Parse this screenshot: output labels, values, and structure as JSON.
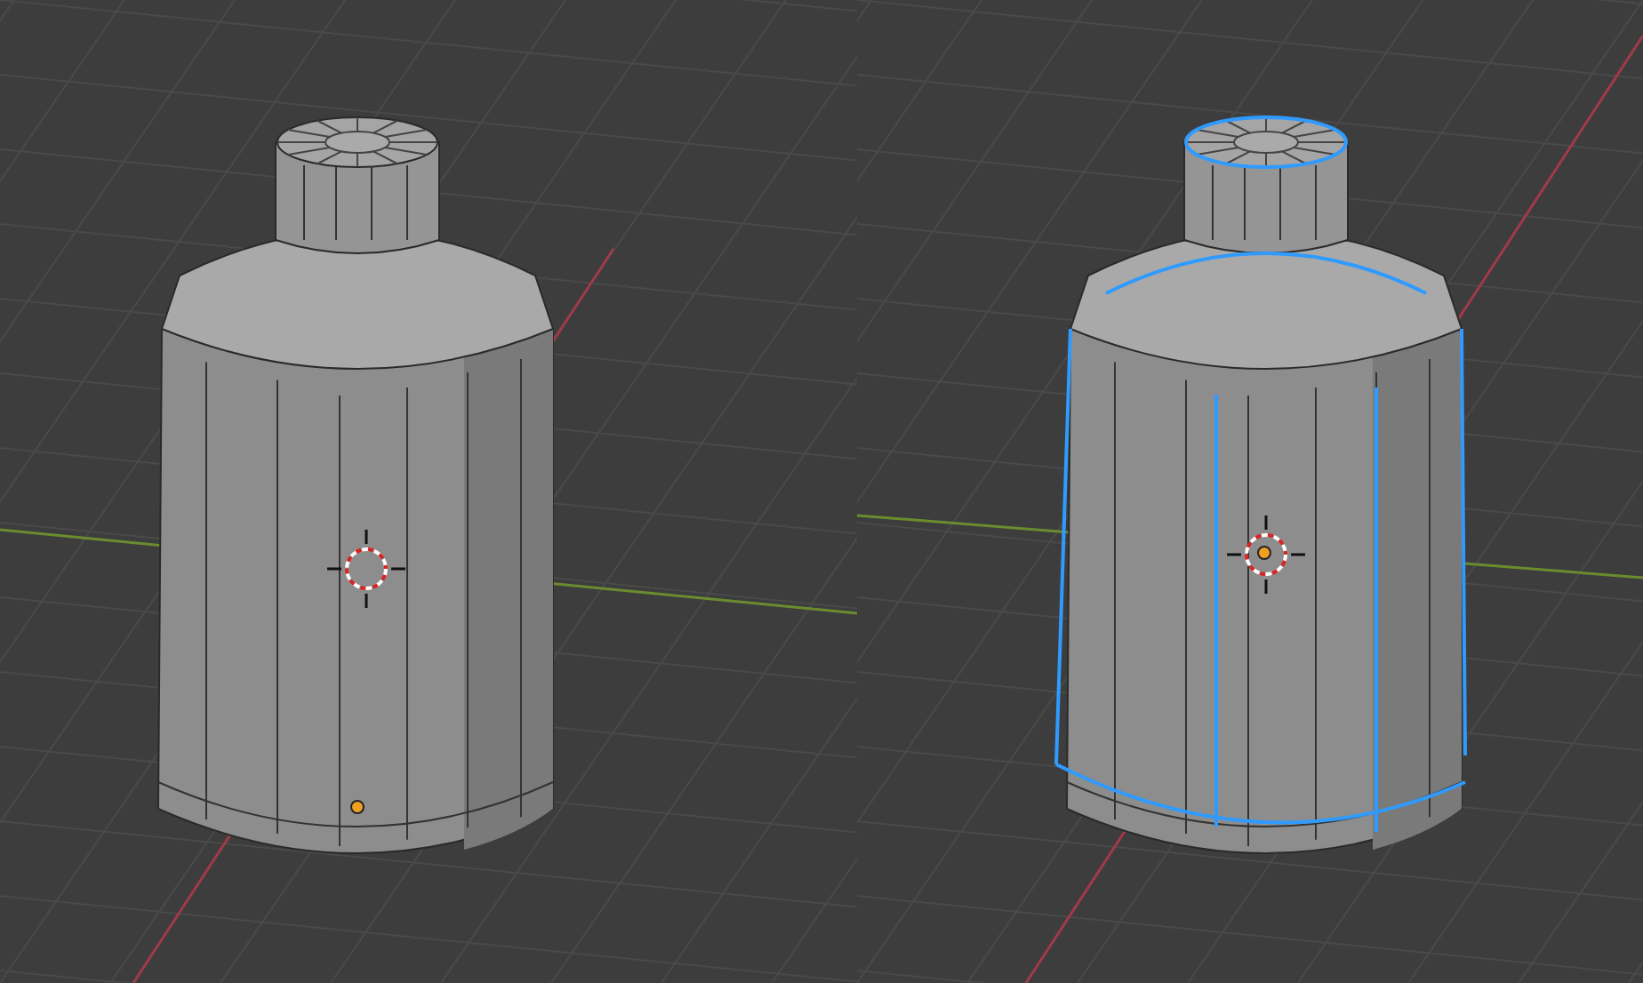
{
  "viewports": [
    {
      "edges_selected": false
    },
    {
      "edges_selected": true
    }
  ]
}
